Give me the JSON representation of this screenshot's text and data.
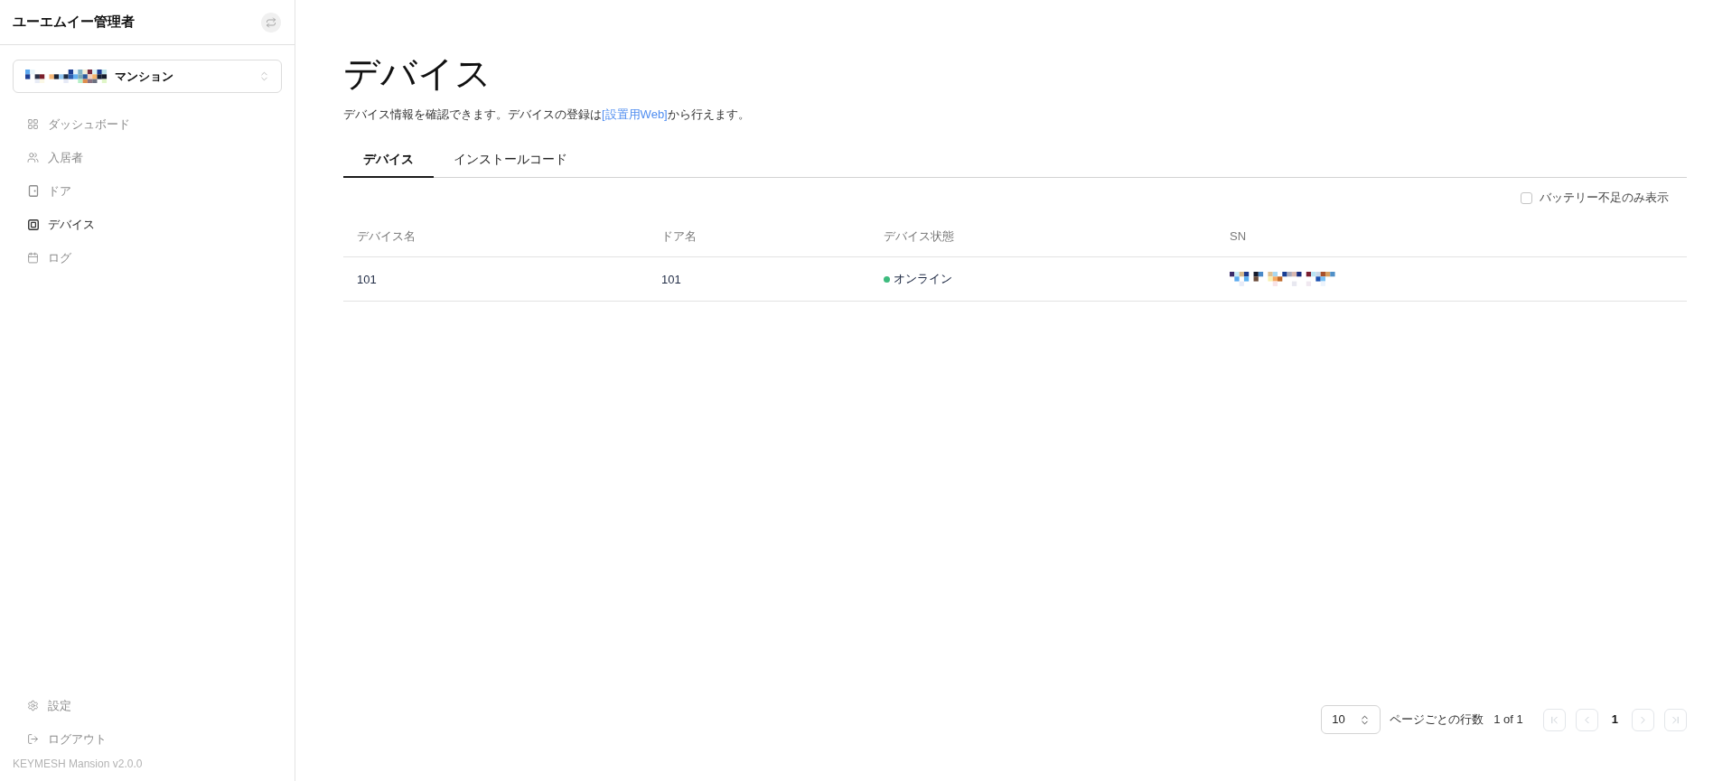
{
  "sidebar": {
    "title": "ユーエムイー管理者",
    "property_select": {
      "value": "マンション"
    },
    "nav_items": [
      {
        "label": "ダッシュボード",
        "selected": false
      },
      {
        "label": "入居者",
        "selected": false
      },
      {
        "label": "ドア",
        "selected": false
      },
      {
        "label": "デバイス",
        "selected": true
      },
      {
        "label": "ログ",
        "selected": false
      }
    ],
    "bottom_items": [
      {
        "label": "設定"
      },
      {
        "label": "ログアウト"
      }
    ],
    "version": "KEYMESH Mansion v2.0.0"
  },
  "page": {
    "title": "デバイス",
    "description": "デバイス情報を確認できます。デバイスの登録は",
    "link": "[設置用Web]",
    "description_end": "から行えます。"
  },
  "tabs": [
    {
      "label": "デバイス",
      "selected": true
    },
    {
      "label": "インストールコード",
      "selected": false
    }
  ],
  "filter": {
    "label": "バッテリー不足のみ表示",
    "checked": false
  },
  "table": {
    "columns": [
      "デバイス名",
      "ドア名",
      "デバイス状態",
      "SN"
    ],
    "rows": [
      {
        "device_name": "101",
        "door_name": "101",
        "status": {
          "label": "オンライン",
          "color": "#3dbb7e"
        }
      }
    ]
  },
  "pagination": {
    "rows_per_page": "10",
    "rows_per_page_label": "ページごとの行数",
    "page_info": "1 of 1",
    "current_page": "1",
    "buttons": [
      {
        "kind": "first",
        "disabled": true
      },
      {
        "kind": "previous",
        "disabled": true
      },
      {
        "kind": "next",
        "disabled": true
      },
      {
        "kind": "last",
        "disabled": true
      }
    ]
  }
}
